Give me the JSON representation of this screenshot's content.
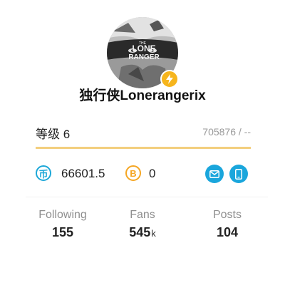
{
  "profile": {
    "username": "独行侠Lonerangerix",
    "avatar_text_line1": "LONE",
    "avatar_text_line2": "RANGER",
    "avatar_text_small": "THE",
    "badge_icon": "lightning-icon"
  },
  "level": {
    "label": "等级 6",
    "exp_text": "705876 / --",
    "progress_fraction": 1.0,
    "bar_color": "#f3cf7e"
  },
  "currency": {
    "coins_icon_glyph": "币",
    "coins_value": "66601.5",
    "bcoin_icon_glyph": "B",
    "bcoin_value": "0",
    "coins_color": "#1ea8d8",
    "bcoin_color": "#f5a623"
  },
  "actions": {
    "message_icon": "mail-icon",
    "phone_icon": "phone-icon",
    "button_color": "#1aa6dc"
  },
  "stats": {
    "following_label": "Following",
    "following_value": "155",
    "fans_label": "Fans",
    "fans_value": "545",
    "fans_unit": "k",
    "posts_label": "Posts",
    "posts_value": "104"
  }
}
